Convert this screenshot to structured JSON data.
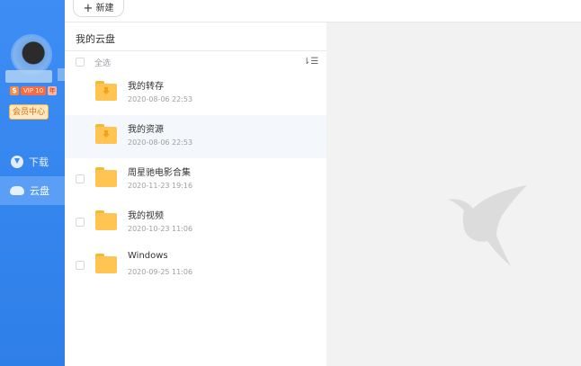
{
  "sidebar": {
    "vip_level": "VIP 10",
    "vip_badge": "年",
    "member_center_label": "会员中心",
    "nav": [
      {
        "label": "下载",
        "icon": "download-icon"
      },
      {
        "label": "云盘",
        "icon": "cloud-icon",
        "active": true
      }
    ]
  },
  "toolbar": {
    "new_label": "新建"
  },
  "list": {
    "breadcrumb": "我的云盘",
    "select_all_label": "全选",
    "items": [
      {
        "name": "我的转存",
        "date": "2020-08-06 22:53",
        "special": "transfer"
      },
      {
        "name": "我的资源",
        "date": "2020-08-06 22:53",
        "special": "resource"
      },
      {
        "name": "周星驰电影合集",
        "date": "2020-11-23 19:16"
      },
      {
        "name": "我的视频",
        "date": "2020-10-23 11:06"
      },
      {
        "name": "Windows",
        "date": "2020-09-25 11:06"
      }
    ]
  },
  "colors": {
    "sidebar": "#3d8df5",
    "folder": "#ffc451",
    "preview_bg": "#f2f2f2"
  }
}
